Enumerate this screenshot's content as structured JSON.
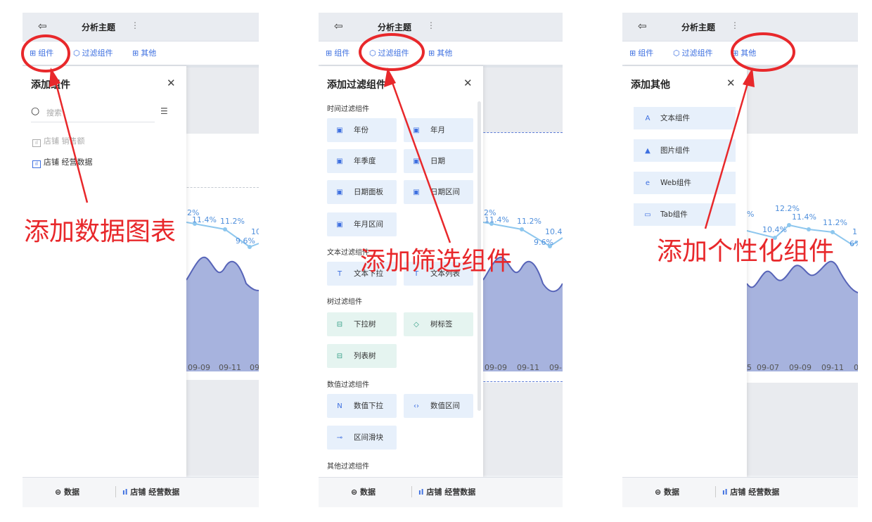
{
  "topbar": {
    "back_icon": "exit-icon",
    "title": "分析主题",
    "more": "⋮"
  },
  "toolbar": {
    "components": "组件",
    "filter_components": "过滤组件",
    "other": "其他"
  },
  "bottombar": {
    "data_label": "数据",
    "dataset_label": "店铺 经营数据"
  },
  "panel1": {
    "drawer_title": "添加组件",
    "search_placeholder": "搜索",
    "items": [
      {
        "label": "店铺 销售额",
        "disabled": true
      },
      {
        "label": "店铺 经营数据",
        "disabled": false
      }
    ],
    "annotation": "添加数据图表"
  },
  "panel2": {
    "drawer_title": "添加过滤组件",
    "sections": {
      "time": "时间过滤组件",
      "text": "文本过滤组件",
      "tree": "树过滤组件",
      "number": "数值过滤组件",
      "other": "其他过滤组件"
    },
    "buttons": {
      "year": "年份",
      "year_month": "年月",
      "year_quarter": "年季度",
      "date": "日期",
      "date_panel": "日期面板",
      "date_range": "日期区间",
      "year_month_range": "年月区间",
      "text_dropdown": "文本下拉",
      "text_list": "文本列表",
      "dropdown_tree": "下拉树",
      "tree_tag": "树标签",
      "list_tree": "列表树",
      "number_dropdown": "数值下拉",
      "number_range": "数值区间",
      "range_slider": "区间滑块"
    },
    "annotation": "添加筛选组件"
  },
  "panel3": {
    "drawer_title": "添加其他",
    "buttons": {
      "text": "文本组件",
      "image": "图片组件",
      "web": "Web组件",
      "tab": "Tab组件"
    },
    "annotation": "添加个性化组件"
  },
  "chart_data": [
    {
      "type": "area",
      "x": [
        "09-09",
        "09-11",
        "09"
      ],
      "point_labels": [
        "2%",
        "11.4%",
        "11.2%",
        "10",
        "9.6%"
      ]
    },
    {
      "type": "area",
      "x": [
        "09-09",
        "09-11",
        "09-"
      ],
      "point_labels": [
        "2%",
        "11.4%",
        "11.2%",
        "10.4",
        "9.6%"
      ]
    },
    {
      "type": "area",
      "x": [
        "5",
        "09-07",
        "09-09",
        "09-11",
        "0"
      ],
      "point_labels": [
        "%",
        "12.2%",
        "10.4%",
        "11.4%",
        "11.2%",
        "1",
        "6%"
      ]
    }
  ],
  "colors": {
    "accent": "#3d6fe0",
    "annotation": "#e8282b",
    "area": "#a7b3de",
    "area_line": "#5764b8",
    "line": "#8ec7ee"
  }
}
